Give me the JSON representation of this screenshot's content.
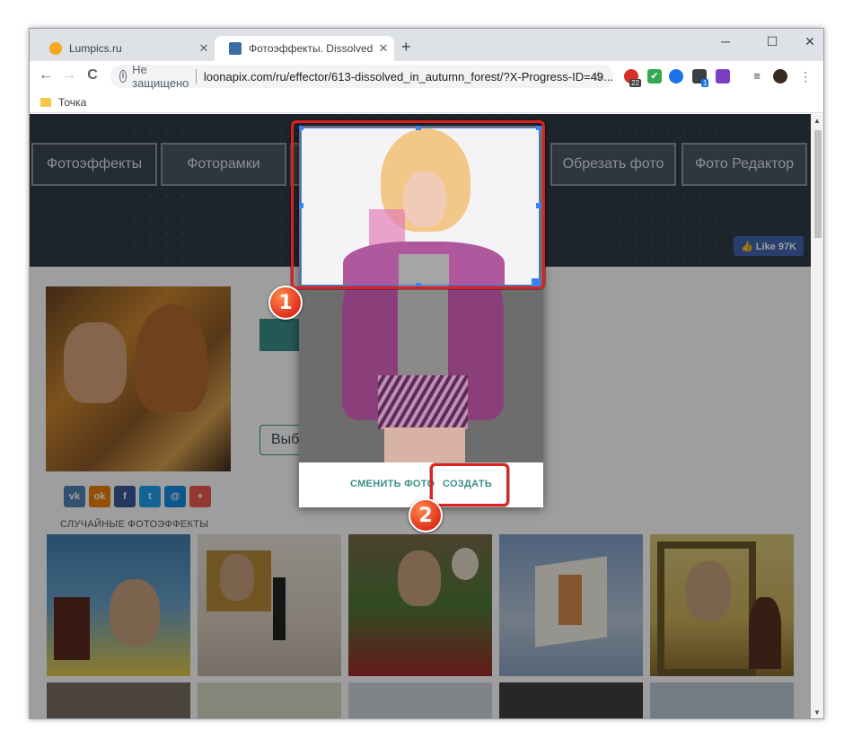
{
  "browser": {
    "tabs": [
      {
        "title": "Lumpics.ru",
        "favicon_color": "#f5a623",
        "active": false
      },
      {
        "title": "Фотоэффекты. Dissolved in autu",
        "favicon_color": "#3a6ea5",
        "active": true
      }
    ],
    "new_tab": "+",
    "window_controls": {
      "minimize": "─",
      "maximize": "☐",
      "close": "✕"
    },
    "nav": {
      "back": "←",
      "forward": "→",
      "reload": "C"
    },
    "omnibox": {
      "info": "i",
      "security_label": "Не защищено",
      "url": "loonapix.com/ru/effector/613-dissolved_in_autumn_forest/?X-Progress-ID=49...",
      "star": "☆"
    },
    "extensions": [
      {
        "name": "adblock-extension",
        "badge": "22",
        "color": "#d93025"
      },
      {
        "name": "checkmark-extension",
        "badge": "",
        "color": "#34a853"
      },
      {
        "name": "vpn-extension",
        "badge": "",
        "color": "#1a73e8"
      },
      {
        "name": "package-extension",
        "badge": "1",
        "color": "#3c4043"
      },
      {
        "name": "ad-extension",
        "badge": "",
        "color": "#7b3fc4"
      }
    ],
    "bookmarks": [
      {
        "label": "Точка"
      }
    ]
  },
  "site": {
    "nav_tabs": [
      {
        "label": "Фотоэффекты",
        "active": true
      },
      {
        "label": "Фоторамки",
        "active": false
      },
      {
        "label": "",
        "active": false
      },
      {
        "label": "Обрезать фото",
        "active": false
      },
      {
        "label": "Фото Редактор",
        "active": false
      }
    ],
    "like_button": "👍 Like 97K",
    "choose_button": "Выб",
    "share_buttons": [
      {
        "name": "vk",
        "label": "vk",
        "color": "#5181b8"
      },
      {
        "name": "odnoklassniki",
        "label": "ok",
        "color": "#ee8208"
      },
      {
        "name": "facebook",
        "label": "f",
        "color": "#3b5998"
      },
      {
        "name": "twitter",
        "label": "t",
        "color": "#1da1f2"
      },
      {
        "name": "mail",
        "label": "@",
        "color": "#168de2"
      },
      {
        "name": "more",
        "label": "+",
        "color": "#ef5b4c"
      }
    ],
    "random_effects_title": "СЛУЧАЙНЫЕ ФОТОЭФФЕКТЫ"
  },
  "modal": {
    "change_photo": "СМЕНИТЬ ФОТО",
    "create": "СОЗДАТЬ"
  },
  "annotations": {
    "badge1": "1",
    "badge2": "2",
    "highlight_color": "#e02020"
  }
}
